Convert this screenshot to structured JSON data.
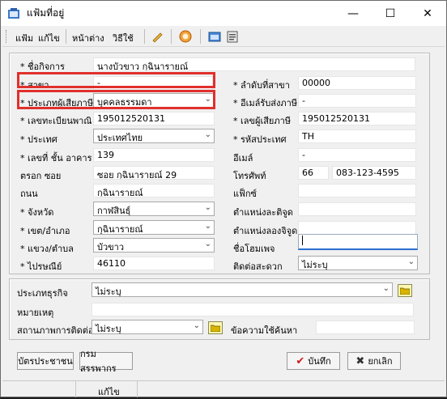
{
  "window": {
    "title": "แฟ้มที่อยู่",
    "minimize": "—",
    "maximize": "☐",
    "close": "✕"
  },
  "menu": {
    "file": "แฟ้ม",
    "edit": "แก้ไข",
    "window": "หน้าต่าง",
    "help": "วิธีใช้"
  },
  "form": {
    "company_name": {
      "label": "* ชื่อกิจการ",
      "value": "นางบัวขาว กุฉินารายณ์"
    },
    "branch": {
      "label": "* สาขา",
      "value": "-"
    },
    "branch_no": {
      "label": "* ลำดับที่สาขา",
      "value": "00000"
    },
    "taxpayer_type": {
      "label": "* ประเภทผู้เสียภาษี",
      "value": "บุคคลธรรมดา"
    },
    "delivery_email": {
      "label": "* อีเมล์รับส่งภาษี",
      "value": "-"
    },
    "civil_id": {
      "label": "* เลขทะเบียนพาณิชย์",
      "value": "195012520131"
    },
    "tax_id": {
      "label": "* เลขผู้เสียภาษี",
      "value": "195012520131"
    },
    "country": {
      "label": "* ประเทศ",
      "value": "ประเทศไทย"
    },
    "country_code": {
      "label": "* รหัสประเทศ",
      "value": "TH"
    },
    "house_no": {
      "label": "* เลขที่ ชั้น อาคาร",
      "value": "139"
    },
    "email": {
      "label": "อีเมล์",
      "value": "-"
    },
    "soi": {
      "label": "ตรอก ซอย",
      "value": "ซอย กุฉินารายณ์ 29"
    },
    "phone": {
      "label": "โทรศัพท์",
      "area": "66",
      "value": "083-123-4595"
    },
    "road": {
      "label": "ถนน",
      "value": "กุฉินารายณ์"
    },
    "fax": {
      "label": "แฟ็กซ์",
      "value": ""
    },
    "province": {
      "label": "* จังหวัด",
      "value": "กาฬสินธุ์"
    },
    "lat": {
      "label": "ตำแหน่งละติจูด",
      "value": ""
    },
    "district": {
      "label": "* เขต/อำเภอ",
      "value": "กุฉินารายณ์"
    },
    "long": {
      "label": "ตำแหน่งลองจิจูด",
      "value": ""
    },
    "subdistrict": {
      "label": "* แขวง/ตำบล",
      "value": "บัวขาว"
    },
    "homepage": {
      "label": "ชื่อโฮมเพจ",
      "value": ""
    },
    "zip": {
      "label": "* ไปรษณีย์",
      "value": "46110"
    },
    "contact_pref": {
      "label": "ติดต่อสะดวก",
      "value": "ไม่ระบุ"
    }
  },
  "extra": {
    "business_type": {
      "label": "ประเภทธุรกิจ",
      "value": "ไม่ระบุ"
    },
    "note": {
      "label": "หมายเหตุ",
      "value": ""
    },
    "contact_status": {
      "label": "สถานภาพการติดต่อ",
      "value": "ไม่ระบุ"
    },
    "search_text": {
      "label": "ข้อความใช้ค้นหา",
      "value": ""
    }
  },
  "buttons": {
    "id_card": "บัตรประชาชน",
    "revenue_dept": "กรมสรรพากร",
    "save": "บันทึก",
    "cancel": "ยกเลิก"
  },
  "status": {
    "mode": "แก้ไข"
  },
  "colors": {
    "highlight": "#e0302c",
    "save_check": "#cc1a1a",
    "cancel_x": "#333333"
  }
}
